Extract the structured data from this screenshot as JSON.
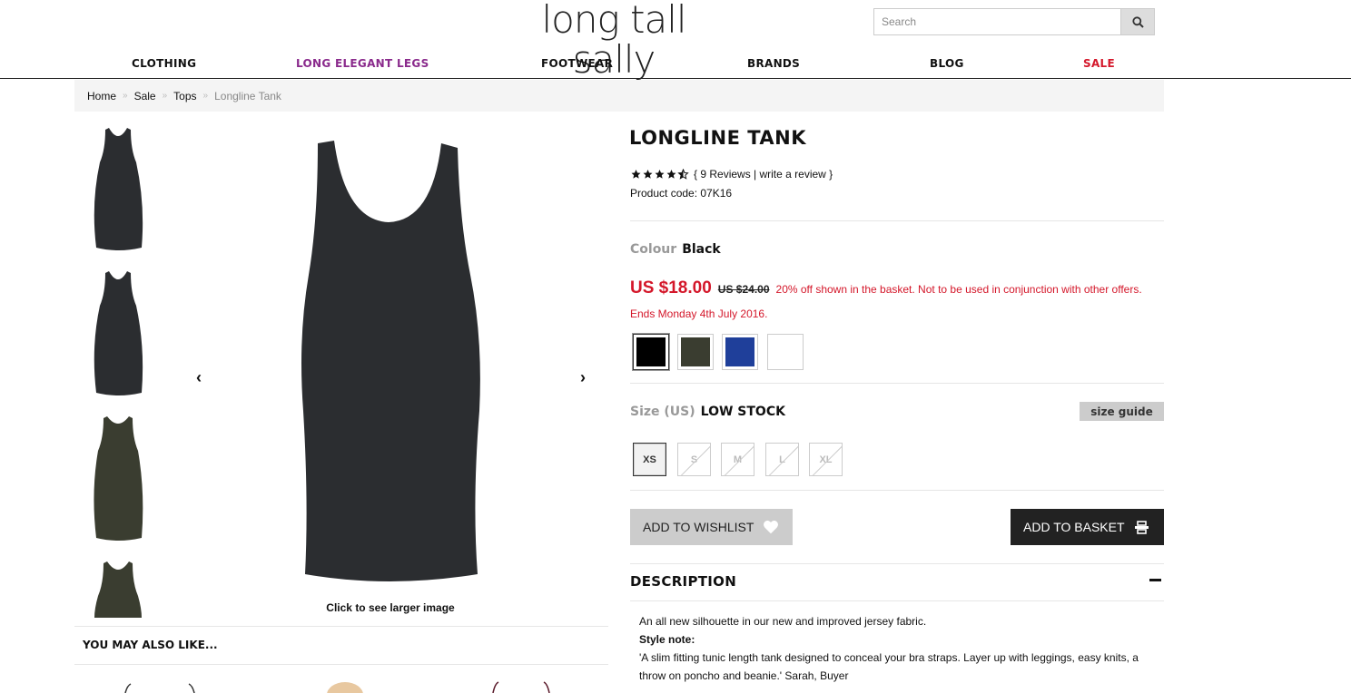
{
  "header": {
    "logo": "long tall sally",
    "search_placeholder": "Search"
  },
  "nav": [
    {
      "label": "CLOTHING",
      "color": "#111111"
    },
    {
      "label": "LONG ELEGANT LEGS",
      "color": "#8a2a8c"
    },
    {
      "label": "FOOTWEAR",
      "color": "#111111"
    },
    {
      "label": "BRANDS",
      "color": "#111111"
    },
    {
      "label": "BLOG",
      "color": "#111111"
    },
    {
      "label": "SALE",
      "color": "#d4172a"
    }
  ],
  "breadcrumb": [
    "Home",
    "Sale",
    "Tops",
    "Longline Tank"
  ],
  "gallery": {
    "thumbnails": [
      {
        "color": "#2b2d30"
      },
      {
        "color": "#2b2d30"
      },
      {
        "color": "#3a3d30"
      },
      {
        "color": "#3a3d30"
      }
    ],
    "main_color": "#2b2d30",
    "caption": "Click to see larger image"
  },
  "also_like": "YOU MAY ALSO LIKE...",
  "product": {
    "title": "LONGLINE TANK",
    "rating": 4.5,
    "reviews_text": "{ 9 Reviews | write a review }",
    "product_code": "Product code: 07K16",
    "colour_label": "Colour",
    "colour_value": "Black",
    "price_now": "US $18.00",
    "price_was": "US $24.00",
    "price_note": "20% off shown in the basket. Not to be used in conjunction with other offers.",
    "offer_ends": "Ends Monday 4th July 2016.",
    "swatches": [
      {
        "name": "black",
        "color": "#000000",
        "selected": true
      },
      {
        "name": "khaki",
        "color": "#3a3d30",
        "selected": false
      },
      {
        "name": "blue",
        "color": "#1f3f9a",
        "selected": false
      },
      {
        "name": "white",
        "color": "#ffffff",
        "selected": false
      }
    ],
    "size_label": "Size (US)",
    "size_stock": "LOW STOCK",
    "size_guide": "size guide",
    "sizes": [
      {
        "label": "XS",
        "available": true
      },
      {
        "label": "S",
        "available": false
      },
      {
        "label": "M",
        "available": false
      },
      {
        "label": "L",
        "available": false
      },
      {
        "label": "XL",
        "available": false
      }
    ],
    "wishlist_label": "ADD TO WISHLIST",
    "basket_label": "ADD TO BASKET",
    "description_heading": "DESCRIPTION",
    "description_intro": "An all new silhouette in our new and improved jersey fabric.",
    "style_note_label": "Style note:",
    "style_note_text": "'A slim fitting tunic length tank designed to conceal your bra straps. Layer up with leggings, easy knits, a throw on poncho and beanie.' Sarah, Buyer"
  },
  "colors": {
    "sale_red": "#d4172a",
    "brand_purple": "#8a2a8c"
  }
}
